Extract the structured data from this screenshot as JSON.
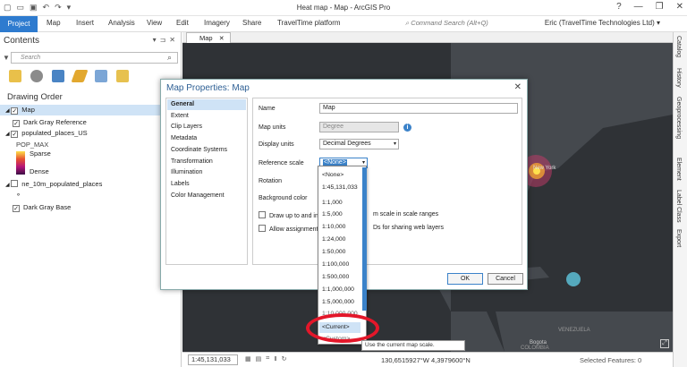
{
  "window": {
    "title": "Heat map - Map - ArcGIS Pro",
    "controls": [
      "?",
      "—",
      "❐",
      "✕"
    ]
  },
  "ribbon": {
    "tabs": [
      "Project",
      "Map",
      "Insert",
      "Analysis",
      "View",
      "Edit",
      "Imagery",
      "Share",
      "TravelTime platform"
    ],
    "command_search_placeholder": "Command Search (Alt+Q)",
    "user": "Eric (TravelTime Technologies Ltd) ▾"
  },
  "contents": {
    "title": "Contents",
    "header_buttons": [
      "▾",
      "⊐",
      "✕"
    ],
    "search_placeholder": "Search",
    "drawing_order_title": "Drawing Order",
    "layers": {
      "map": "Map",
      "dark_gray_reference": "Dark Gray Reference",
      "populated_places_us": "populated_places_US",
      "pop_max": "POP_MAX",
      "sparse": "Sparse",
      "dense": "Dense",
      "ne_10m": "ne_10m_populated_places",
      "dark_gray_base": "Dark Gray Base"
    }
  },
  "map_tab": "Map",
  "map_labels": {
    "new_york": "New York",
    "bogota": "Bogota",
    "venezuela": "VENEZUELA",
    "colombia": "COLOMBIA"
  },
  "right_rail": [
    "Catalog",
    "History",
    "Geoprocessing",
    "Element",
    "Label Class",
    "Export"
  ],
  "status_bar": {
    "scale": "1:45,131,033",
    "coords": "130,6515927°W 4,3979600°N",
    "selected": "Selected Features: 0"
  },
  "dialog": {
    "title": "Map Properties: Map",
    "nav": [
      "General",
      "Extent",
      "Clip Layers",
      "Metadata",
      "Coordinate Systems",
      "Transformation",
      "Illumination",
      "Labels",
      "Color Management"
    ],
    "selected_nav": "General",
    "fields": {
      "name_label": "Name",
      "name_value": "Map",
      "map_units_label": "Map units",
      "map_units_value": "Degree",
      "display_units_label": "Display units",
      "display_units_value": "Decimal Degrees",
      "reference_scale_label": "Reference scale",
      "reference_scale_value": "<None>",
      "rotation_label": "Rotation",
      "background_label": "Background color",
      "check1_left": "Draw up to and incl",
      "check1_right": "m scale in scale ranges",
      "check2_left": "Allow assignment o",
      "check2_right": "Ds for sharing web layers"
    },
    "ok": "OK",
    "cancel": "Cancel"
  },
  "dropdown": {
    "items": [
      "<None>",
      "1:45,131,033",
      "1:1,000",
      "1:5,000",
      "1:10,000",
      "1:24,000",
      "1:50,000",
      "1:100,000",
      "1:500,000",
      "1:1,000,000",
      "1:5,000,000",
      "1:10,000,000"
    ],
    "current": "<Current>",
    "custom": "<Custom>",
    "tooltip": "Use the current map scale."
  },
  "colors": {
    "accent": "#2e7bcf",
    "map_bg": "#2f3236",
    "highlight": "#e3172a"
  }
}
